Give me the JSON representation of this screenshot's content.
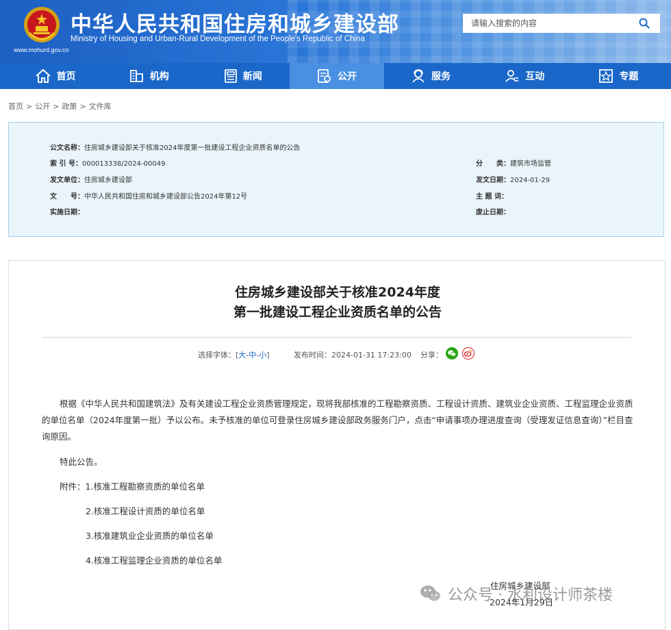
{
  "header": {
    "title": "中华人民共和国住房和城乡建设部",
    "subtitle_en": "Ministry of Housing and Urban-Rural Development of the People's Republic of China",
    "url": "www.mohurd.gov.cn",
    "emblem_icon": "national-emblem-icon",
    "search": {
      "placeholder": "请输入搜索的内容",
      "icon": "search-icon"
    }
  },
  "nav": {
    "items": [
      {
        "label": "首页",
        "icon": "home-icon"
      },
      {
        "label": "机构",
        "icon": "building-icon"
      },
      {
        "label": "新闻",
        "icon": "news-icon"
      },
      {
        "label": "公开",
        "icon": "disclosure-icon",
        "active": true
      },
      {
        "label": "服务",
        "icon": "service-icon"
      },
      {
        "label": "互动",
        "icon": "interact-icon"
      },
      {
        "label": "专题",
        "icon": "topic-icon"
      }
    ],
    "bg_color": "#1a67c9",
    "active_color": "#4a90e2"
  },
  "breadcrumb": {
    "items": [
      "首页",
      "公开",
      "政策",
      "文件库"
    ],
    "separator": ">"
  },
  "meta": {
    "doc_name_label": "公文名称：",
    "doc_name_value": "住房城乡建设部关于核准2024年度第一批建设工程企业资质名单的公告",
    "index_label": "索 引 号：",
    "index_value": "000013338/2024-00049",
    "category_label": "分　　类：",
    "category_value": "建筑市场监管",
    "issuer_label": "发文单位：",
    "issuer_value": "住房城乡建设部",
    "issue_date_label": "发文日期：",
    "issue_date_value": "2024-01-29",
    "doc_no_label": "文　　号：",
    "doc_no_value": "中华人民共和国住房和城乡建设部公告2024年第12号",
    "keywords_label": "主 题 词：",
    "keywords_value": "",
    "effective_label": "实施日期：",
    "effective_value": "",
    "expiry_label": "废止日期：",
    "expiry_value": ""
  },
  "article": {
    "title_line1": "住房城乡建设部关于核准2024年度",
    "title_line2": "第一批建设工程企业资质名单的公告",
    "font_select_label": "选择字体：[",
    "font_large": "大",
    "font_medium": "中",
    "font_small": "小",
    "font_sep": "-",
    "font_select_end": "]",
    "publish_label": "发布时间：",
    "publish_time": "2024-01-31 17:23:00",
    "share_label": "分享：",
    "paragraph1": "根据《中华人民共和国建筑法》及有关建设工程企业资质管理规定，现将我部核准的工程勘察资质、工程设计资质、建筑业企业资质、工程监理企业资质的单位名单（2024年度第一批）予以公布。未予核准的单位可登录住房城乡建设部政务服务门户，点击“申请事项办理进度查询（受理发证信息查询）”栏目查询原因。",
    "paragraph2": "特此公告。",
    "attachments_label": "附件：",
    "attachments": [
      "1.核准工程勘察资质的单位名单",
      "2.核准工程设计资质的单位名单",
      "3.核准建筑业企业资质的单位名单",
      "4.核准工程监理企业资质的单位名单"
    ],
    "signature_org": "住房城乡建设部",
    "signature_date": "2024年1月29日"
  },
  "watermark": {
    "text": "公众号 · 水利设计师茶楼",
    "icon": "wechat-icon"
  }
}
